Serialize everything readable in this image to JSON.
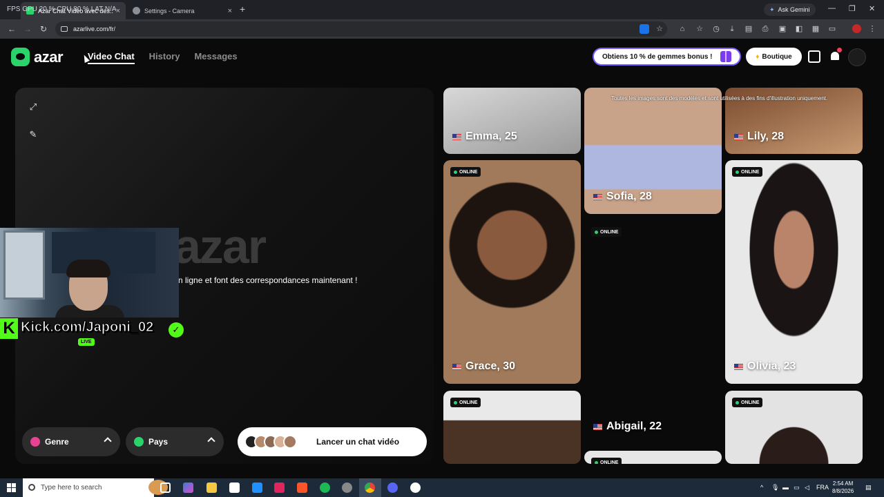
{
  "browser": {
    "overlay_stats": "FPS    GPU 20 %    CPU 80 %    LAT N/A",
    "tabs": [
      {
        "title": "Azar Chat Vidéo avec des...",
        "close": "×"
      },
      {
        "title": "Settings - Camera",
        "close": "×"
      }
    ],
    "new_tab": "+",
    "ask_gemini": "Ask Gemini",
    "url": "azarlive.com/fr/",
    "window_controls": [
      "—",
      "❐",
      "✕"
    ]
  },
  "header": {
    "logo": "azar",
    "nav": [
      {
        "label": "Video Chat",
        "active": true
      },
      {
        "label": "History",
        "active": false
      },
      {
        "label": "Messages",
        "active": false
      }
    ],
    "promo": "Obtiens 10 % de gemmes bonus !",
    "shop": "Boutique",
    "notification_count": "1"
  },
  "main": {
    "watermark": "azar",
    "tagline": "n ligne et font des correspondances maintenant !",
    "filters": [
      {
        "label": "Genre",
        "icon": "gender-icon",
        "color": "#e84393"
      },
      {
        "label": "Pays",
        "icon": "globe-icon",
        "color": "#2bd46b"
      }
    ],
    "start_button": "Lancer un chat vidéo"
  },
  "streamer": {
    "handle": "Kick.com/Japoni_02",
    "live": "LIVE",
    "brand_letter": "K",
    "check": "✓"
  },
  "grid": {
    "disclaimer": "Toutes les images sont des modèles et sont utilisées à des fins d'illustration uniquement.",
    "online_label": "ONLINE",
    "profiles": [
      {
        "name": "Emma, 25"
      },
      {
        "name": "Sofia, 28"
      },
      {
        "name": "Lily, 28"
      },
      {
        "name": "Grace, 30"
      },
      {
        "name": "Olivia, 23"
      },
      {
        "name": "Abigail, 22"
      }
    ]
  },
  "taskbar": {
    "search_placeholder": "Type here to search",
    "lang": "FRA",
    "time": "2:54 AM",
    "date": "8/8/2026"
  }
}
